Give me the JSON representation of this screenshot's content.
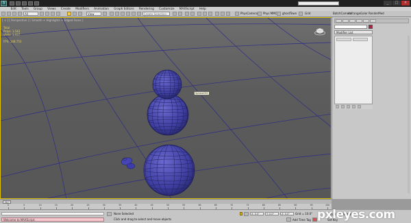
{
  "menus": [
    "Edit",
    "Tools",
    "Group",
    "Views",
    "Create",
    "Modifiers",
    "Animation",
    "Graph Editors",
    "Rendering",
    "Customize",
    "MAXScript",
    "Help"
  ],
  "toolbar": {
    "selection_filter": "All",
    "coord_system": "View",
    "named_selection": "Create Selection Set",
    "ribbon_labels": [
      "PhysCamera",
      "Phys MMO",
      "ghostTown",
      "Grid",
      "BatchCamera",
      "defrangeGalor",
      "RenderMed"
    ]
  },
  "viewport": {
    "label": "[ + ] [ Perspective ] [ Smooth + Highlights + Edged Faces ]",
    "stats": [
      {
        "name": "Total",
        "value": ""
      },
      {
        "name": "Polys:",
        "value": "1,542"
      },
      {
        "name": "Verts:",
        "value": "1,437"
      },
      {
        "name": "FPS:",
        "value": "148.753"
      }
    ],
    "tooltip": "Sphere001"
  },
  "command_panel": {
    "modifier_list": "Modifier List"
  },
  "timeline": {
    "position": "0 / 100",
    "ticks": [
      "0",
      "5",
      "10",
      "15",
      "20",
      "25",
      "30",
      "35",
      "40",
      "45",
      "50",
      "55",
      "60",
      "65",
      "70",
      "75",
      "80",
      "85",
      "90",
      "95",
      "100"
    ]
  },
  "status": {
    "selection": "None Selected",
    "prompt": "Click and drag to select and move objects",
    "maxscript_listener": "Welcome to MAXScript.",
    "x_field": "X: 0.0\"",
    "y_field": "Y: 0.0\"",
    "z_field": "Z: 0.0\"",
    "grid": "Grid = 10.0\"",
    "auto_key": "Auto Key",
    "set_key": "Set Key",
    "add_time_tag": "Add Time Tag",
    "selected": "Selected"
  },
  "watermark": "pxleyes.com",
  "colors": {
    "viewport_border": "#e0c200",
    "wireframe": "#2a2a88",
    "sphere_fill": "#4b4bb0",
    "stat_text": "#e8d25a"
  }
}
